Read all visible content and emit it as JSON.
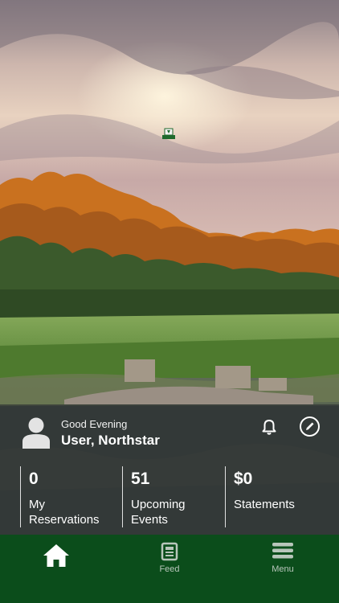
{
  "header": {
    "greeting": "Good Evening",
    "user_name": "User, Northstar"
  },
  "icons": {
    "avatar": "user-avatar-icon",
    "notifications": "bell-icon",
    "edit": "pencil-circle-icon",
    "logo": "club-crest-logo"
  },
  "stats": [
    {
      "value": "0",
      "label": "My Reservations"
    },
    {
      "value": "51",
      "label": "Upcoming Events"
    },
    {
      "value": "$0",
      "label": "Statements"
    }
  ],
  "tabbar": {
    "items": [
      {
        "label": "",
        "icon": "home-icon",
        "active": true
      },
      {
        "label": "Feed",
        "icon": "newspaper-icon",
        "active": false
      },
      {
        "label": "Menu",
        "icon": "hamburger-menu-icon",
        "active": false
      }
    ]
  },
  "colors": {
    "tabbar_bg": "#0b4d1b",
    "active_icon": "#ffffff",
    "inactive_icon": "#b8c6bb"
  }
}
